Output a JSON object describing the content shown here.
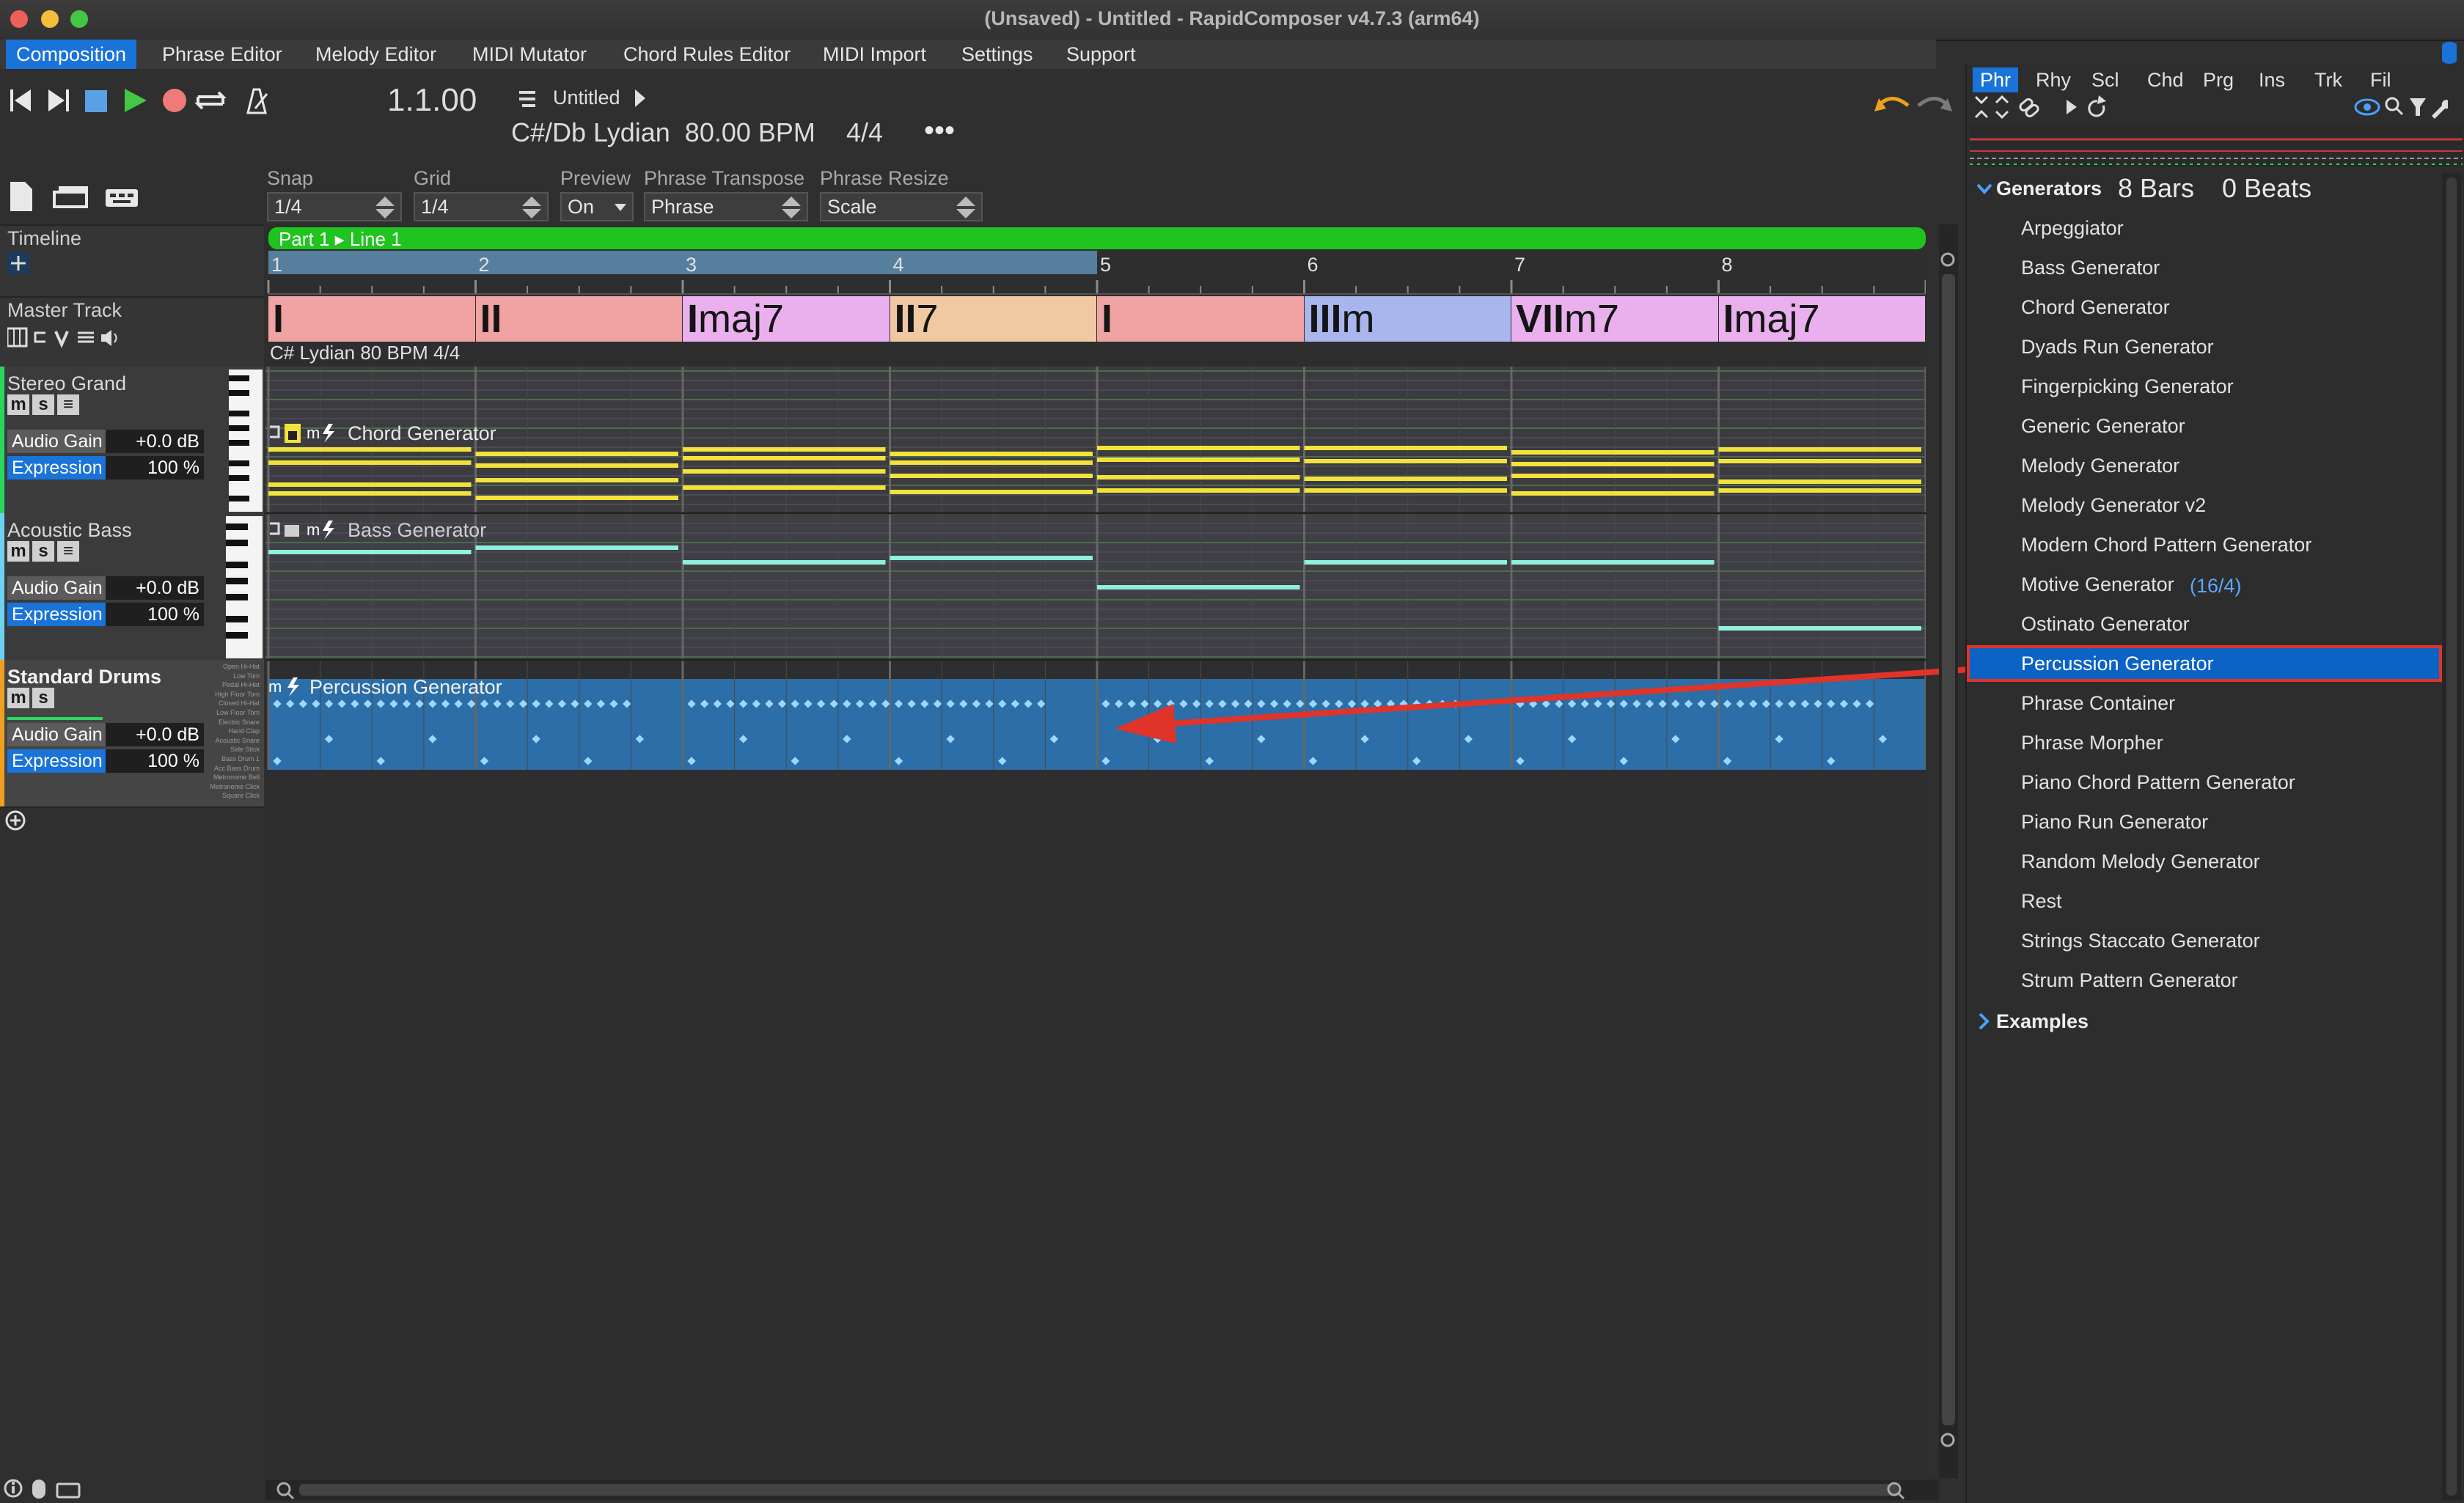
{
  "window": {
    "title": "(Unsaved) - Untitled - RapidComposer v4.7.3 (arm64)"
  },
  "menu": [
    "Composition",
    "Phrase Editor",
    "Melody Editor",
    "MIDI Mutator",
    "Chord Rules Editor",
    "MIDI Import",
    "Settings",
    "Support"
  ],
  "transport": {
    "position": "1.1.00",
    "song_title": "Untitled",
    "key_tempo": "C#/Db Lydian  80.00 BPM",
    "time_sig": "4/4",
    "more": "•••"
  },
  "options": {
    "snap": {
      "label": "Snap",
      "value": "1/4"
    },
    "grid": {
      "label": "Grid",
      "value": "1/4"
    },
    "preview": {
      "label": "Preview",
      "value": "On"
    },
    "phrase_transpose": {
      "label": "Phrase Transpose",
      "value": "Phrase"
    },
    "phrase_resize": {
      "label": "Phrase Resize",
      "value": "Scale"
    }
  },
  "timeline": {
    "label": "Timeline",
    "part_label": "Part 1 ▸ Line 1",
    "bars": [
      "1",
      "2",
      "3",
      "4",
      "5",
      "6",
      "7",
      "8"
    ]
  },
  "master": {
    "label": "Master Track",
    "info": "C# Lydian 80 BPM 4/4",
    "chords": [
      {
        "roman": "I",
        "suffix": ""
      },
      {
        "roman": "II",
        "suffix": ""
      },
      {
        "roman": "I",
        "suffix": "maj7"
      },
      {
        "roman": "II",
        "suffix": "7"
      },
      {
        "roman": "I",
        "suffix": ""
      },
      {
        "roman": "III",
        "suffix": "m"
      },
      {
        "roman": "VII",
        "suffix": "m7"
      },
      {
        "roman": "I",
        "suffix": "maj7"
      }
    ]
  },
  "tracks": [
    {
      "name": "Stereo Grand",
      "gain_label": "Audio Gain",
      "gain": "+0.0 dB",
      "expr_label": "Expression",
      "expr": "100 %",
      "phrase": "Chord Generator"
    },
    {
      "name": "Acoustic Bass",
      "gain_label": "Audio Gain",
      "gain": "+0.0 dB",
      "expr_label": "Expression",
      "expr": "100 %",
      "phrase": "Bass Generator"
    },
    {
      "name": "Standard Drums",
      "gain_label": "Audio Gain",
      "gain": "+0.0 dB",
      "expr_label": "Expression",
      "expr": "100 %",
      "phrase": "Percussion Generator"
    }
  ],
  "drum_rows": [
    "Open Hi-Hat",
    "Low Tom",
    "Pedal Hi-Hat",
    "High Floor Tom",
    "Closed Hi-Hat",
    "Low Floor Tom",
    "Electric Snare",
    "Hand Clap",
    "Acoustic Snare",
    "Side Stick",
    "Bass Drum 1",
    "Acc Bass Drum",
    "Metronome Bell",
    "Metronome Click",
    "Square Click"
  ],
  "panel": {
    "tabs": [
      "Phr",
      "Rhy",
      "Scl",
      "Chd",
      "Prg",
      "Ins",
      "Trk",
      "Fil"
    ],
    "section": "Generators",
    "bars": "8 Bars",
    "beats": "0 Beats",
    "generators": [
      "Arpeggiator",
      "Bass Generator",
      "Chord Generator",
      "Dyads Run Generator",
      "Fingerpicking Generator",
      "Generic Generator",
      "Melody Generator",
      "Melody Generator v2",
      "Modern Chord Pattern Generator",
      "Motive Generator",
      "Ostinato Generator",
      "Percussion Generator",
      "Phrase Container",
      "Phrase Morpher",
      "Piano Chord Pattern Generator",
      "Piano Run Generator",
      "Random Melody Generator",
      "Rest",
      "Strings Staccato Generator",
      "Strum Pattern Generator"
    ],
    "motive_count": "(16/4)",
    "selected": "Percussion Generator",
    "examples": "Examples"
  },
  "colors": {
    "accent": "#1a73d8",
    "part_bar": "#1fc41f",
    "chord_yellow": "#f2e23c",
    "bass_teal": "#8ff0dc",
    "drum_blue": "#2c7fc4",
    "arrow": "#e0342b"
  }
}
